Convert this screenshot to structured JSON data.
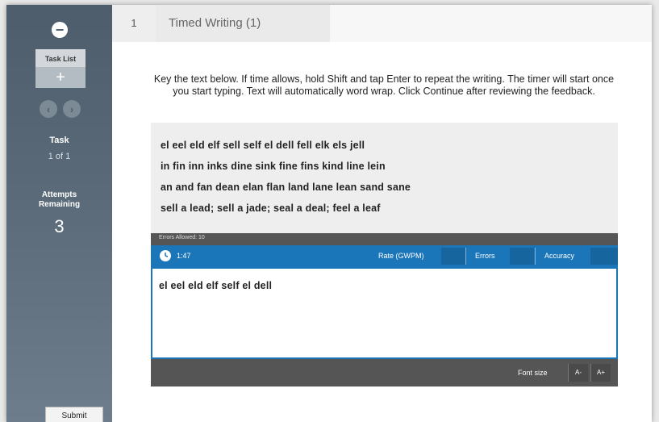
{
  "sidebar": {
    "minus": "−",
    "task_list_label": "Task List",
    "task_list_plus": "+",
    "prev": "‹",
    "next": "›",
    "task_label": "Task",
    "task_value": "1 of 1",
    "attempts_label": "Attempts Remaining",
    "attempts_value": "3",
    "submit_label": "Submit"
  },
  "header": {
    "number": "1",
    "title": "Timed Writing (1)"
  },
  "instructions": "Key the text below. If time allows, hold Shift and tap Enter to repeat the writing. The timer will start once you start typing. Text will automatically word wrap. Click Continue after reviewing the feedback.",
  "source_lines": [
    "el eel eld elf sell self el dell fell elk els jell",
    "in fin inn inks dine sink fine fins kind line lein",
    "an and fan dean elan flan land lane lean sand sane",
    "sell a lead; sell a jade; seal a deal; feel a leaf"
  ],
  "editor": {
    "top_label": "Errors Allowed: 10",
    "timer": "1:47",
    "rate_label": "Rate (GWPM)",
    "errors_label": "Errors",
    "accuracy_label": "Accuracy",
    "typed_text": "el eel eld elf self el dell",
    "font_size_label": "Font size",
    "font_decrease": "A-",
    "font_increase": "A+"
  },
  "colors": {
    "accent": "#1b76b9",
    "sidebar": "#4d5d6b"
  }
}
